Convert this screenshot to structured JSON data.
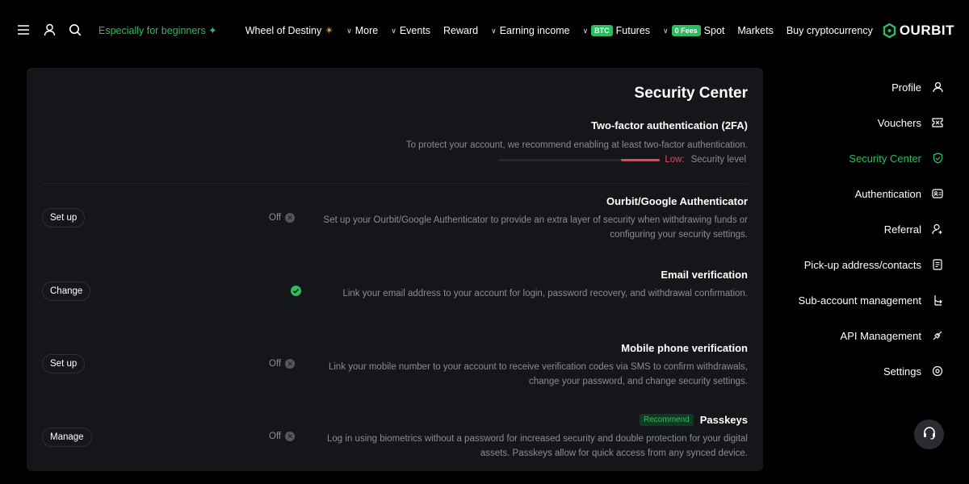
{
  "nav": {
    "beginners": "Especially for beginners ✦",
    "wheel": "Wheel of Destiny",
    "more": "More",
    "events": "Events",
    "reward": "Reward",
    "earning": "Earning income",
    "futures_badge": "BTC",
    "futures": "Futures",
    "spot_badge": "0 Fees",
    "spot": "Spot",
    "markets": "Markets",
    "buy": "Buy cryptocurrency",
    "logo": "OURBIT"
  },
  "main": {
    "title": "Security Center",
    "twofa_title": "Two-factor authentication (2FA)",
    "twofa_desc": "To protect your account, we recommend enabling at least two-factor authentication.",
    "level_value": "Low:",
    "level_label": "Security level",
    "level_fraction": 0.24,
    "rows": [
      {
        "button": "Set up",
        "status": "Off",
        "title": "Ourbit/Google Authenticator",
        "desc": "Set up your Ourbit/Google Authenticator to provide an extra layer of security when withdrawing funds or configuring your security settings."
      },
      {
        "button": "Change",
        "status": "",
        "title": "Email verification",
        "desc": "Link your email address to your account for login, password recovery, and withdrawal confirmation."
      },
      {
        "button": "Set up",
        "status": "Off",
        "title": "Mobile phone verification",
        "desc": "Link your mobile number to your account to receive verification codes via SMS to confirm withdrawals, change your password, and change security settings."
      },
      {
        "button": "Manage",
        "status": "Off",
        "badge": "Recommend",
        "title": "Passkeys",
        "desc": "Log in using biometrics without a password for increased security and double protection for your digital assets. Passkeys allow for quick access from any synced device."
      }
    ]
  },
  "sidebar": {
    "items": [
      {
        "label": "Profile",
        "icon": "user-icon"
      },
      {
        "label": "Vouchers",
        "icon": "voucher-icon"
      },
      {
        "label": "Security Center",
        "icon": "shield-icon"
      },
      {
        "label": "Authentication",
        "icon": "id-card-icon"
      },
      {
        "label": "Referral",
        "icon": "referral-icon"
      },
      {
        "label": "Pick-up address/contacts",
        "icon": "address-book-icon"
      },
      {
        "label": "Sub-account management",
        "icon": "sub-account-icon"
      },
      {
        "label": "API Management",
        "icon": "api-icon"
      },
      {
        "label": "Settings",
        "icon": "settings-icon"
      }
    ]
  },
  "colors": {
    "accent": "#2dbd5f",
    "danger": "#e8455d",
    "panel": "#15161a",
    "muted": "#8a8d93"
  }
}
